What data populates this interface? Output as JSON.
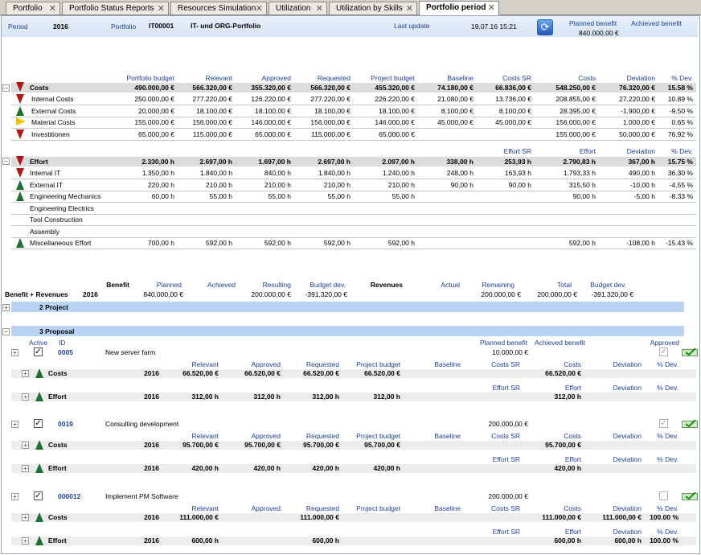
{
  "tabs": [
    {
      "label": "Portfolio",
      "active": false
    },
    {
      "label": "Portfolio Status Reports",
      "active": false
    },
    {
      "label": "Resources Simulation",
      "active": false
    },
    {
      "label": "Utilization",
      "active": false
    },
    {
      "label": "Utilization by Skills",
      "active": false
    },
    {
      "label": "Portfolio period",
      "active": true
    }
  ],
  "header": {
    "period_label": "Period",
    "period": "2016",
    "portfolio_label": "Portfolio",
    "portfolio_id": "IT00001",
    "portfolio_name": "IT- und ORG-Portfolio",
    "last_update_label": "Last update",
    "last_update": "19.07.16 15:21",
    "planned_label": "Planned benefit",
    "planned": "840.000,00 €",
    "achieved_label": "Achieved benefit"
  },
  "budget": {
    "columns": [
      "Portfolio budget",
      "Relevant",
      "Approved",
      "Requested",
      "Project budget",
      "Baseline",
      "Costs SR",
      "Costs",
      "Deviation",
      "% Dev."
    ],
    "costs": {
      "label": "Costs",
      "values": [
        "490.000,00 €",
        "566.320,00 €",
        "355.320,00 €",
        "566.320,00 €",
        "455.320,00 €",
        "74.180,00 €",
        "66.836,00 €",
        "548.250,00 €",
        "76.320,00 €",
        "15.58 %"
      ]
    },
    "cost_rows": [
      {
        "label": "Internal Costs",
        "indicator": "down",
        "values": [
          "250.000,00 €",
          "277.220,00 €",
          "126.220,00 €",
          "277.220,00 €",
          "226.220,00 €",
          "21.080,00 €",
          "13.736,00 €",
          "208.855,00 €",
          "27.220,00 €",
          "10.89 %"
        ]
      },
      {
        "label": "External Costs",
        "indicator": "up",
        "values": [
          "20.000,00 €",
          "18.100,00 €",
          "18.100,00 €",
          "18.100,00 €",
          "18.100,00 €",
          "8.100,00 €",
          "8.100,00 €",
          "28.395,00 €",
          "-1.900,00 €",
          "-9.50 %"
        ]
      },
      {
        "label": "Material Costs",
        "indicator": "flag",
        "values": [
          "155.000,00 €",
          "156.000,00 €",
          "146.000,00 €",
          "156.000,00 €",
          "146.000,00 €",
          "45.000,00 €",
          "45.000,00 €",
          "156.000,00 €",
          "1.000,00 €",
          "0.65 %"
        ]
      },
      {
        "label": "Investitionen",
        "indicator": "down",
        "values": [
          "65.000,00 €",
          "115.000,00 €",
          "65.000,00 €",
          "115.000,00 €",
          "65.000,00 €",
          "",
          "",
          "155.000,00 €",
          "50.000,00 €",
          "76.92 %"
        ]
      }
    ],
    "effort_columns": [
      "Effort SR",
      "Effort",
      "Deviation",
      "% Dev."
    ],
    "effort": {
      "label": "Effort",
      "values": [
        "2.330,00 h",
        "2.697,00 h",
        "1.697,00 h",
        "2.697,00 h",
        "2.097,00 h",
        "338,00 h",
        "253,93 h",
        "2.790,83 h",
        "367,00 h",
        "15.75 %"
      ]
    },
    "effort_rows": [
      {
        "label": "Internal IT",
        "indicator": "down",
        "values": [
          "1.350,00 h",
          "1.840,00 h",
          "840,00 h",
          "1.840,00 h",
          "1.240,00 h",
          "248,00 h",
          "163,93 h",
          "1.793,33 h",
          "490,00 h",
          "36.30 %"
        ]
      },
      {
        "label": "External IT",
        "indicator": "up",
        "values": [
          "220,00 h",
          "210,00 h",
          "210,00 h",
          "210,00 h",
          "210,00 h",
          "90,00 h",
          "90,00 h",
          "315,50 h",
          "-10,00 h",
          "-4.55 %"
        ]
      },
      {
        "label": "Engineering Mechanics",
        "indicator": "up",
        "values": [
          "60,00 h",
          "55,00 h",
          "55,00 h",
          "55,00 h",
          "55,00 h",
          "",
          "",
          "90,00 h",
          "-5,00 h",
          "-8.33 %"
        ]
      },
      {
        "label": "Engineering Electrics",
        "indicator": "",
        "values": [
          "",
          "",
          "",
          "",
          "",
          "",
          "",
          "",
          "",
          ""
        ]
      },
      {
        "label": "Tool Construction",
        "indicator": "",
        "values": [
          "",
          "",
          "",
          "",
          "",
          "",
          "",
          "",
          "",
          ""
        ]
      },
      {
        "label": "Assembly",
        "indicator": "",
        "values": [
          "",
          "",
          "",
          "",
          "",
          "",
          "",
          "",
          "",
          ""
        ]
      },
      {
        "label": "Miscellaneous Effort",
        "indicator": "up",
        "values": [
          "700,00 h",
          "592,00 h",
          "592,00 h",
          "592,00 h",
          "592,00 h",
          "",
          "",
          "592,00 h",
          "-108,00 h",
          "-15.43 %"
        ]
      }
    ]
  },
  "benefit": {
    "benefit_label": "Benefit",
    "planned_label": "Planned",
    "achieved_label": "Achieved",
    "resulting_label": "Resulting",
    "budget_dev_label": "Budget dev.",
    "revenues_label": "Revenues",
    "actual_label": "Actual",
    "remaining_label": "Remaining",
    "total_label": "Total",
    "budget_dev2_label": "Budget dev.",
    "row_label": "Benefit + Revenues",
    "year": "2016",
    "planned": "840.000,00 €",
    "resulting": "200.000,00 €",
    "budget_dev": "-391.320,00 €",
    "remaining": "200.000,00 €",
    "total": "200.000,00 €",
    "budget_dev2": "-391.320,00 €"
  },
  "groups": {
    "project": "2 Project",
    "proposal": "3 Proposal"
  },
  "proposal_header": {
    "active": "Active",
    "id": "ID",
    "planned": "Planned benefit",
    "achieved": "Achieved benefit",
    "approved": "Approved"
  },
  "sub_columns": {
    "relevant": "Relevant",
    "approved": "Approved",
    "requested": "Requested",
    "project_budget": "Project budget",
    "baseline": "Baseline",
    "costs_sr": "Costs SR",
    "costs": "Costs",
    "deviation": "Deviation",
    "pct_dev": "% Dev.",
    "effort_sr": "Effort SR",
    "effort": "Effort"
  },
  "proposals": [
    {
      "id": "0005",
      "name": "New server farm",
      "planned": "10.000,00 €",
      "approved": true,
      "costs": {
        "label": "Costs",
        "year": "2016",
        "relevant": "66.520,00 €",
        "approved": "66.520,00 €",
        "requested": "66.520,00 €",
        "project_budget": "66.520,00 €",
        "costs": "66.520,00 €",
        "deviation": "",
        "pct_dev": ""
      },
      "effort": {
        "label": "Effort",
        "year": "2016",
        "relevant": "312,00 h",
        "approved": "312,00 h",
        "requested": "312,00 h",
        "project_budget": "312,00 h",
        "effort": "312,00 h"
      }
    },
    {
      "id": "0019",
      "name": "Consulting development",
      "planned": "200.000,00 €",
      "approved": true,
      "costs": {
        "label": "Costs",
        "year": "2016",
        "relevant": "95.700,00 €",
        "approved": "95.700,00 €",
        "requested": "95.700,00 €",
        "project_budget": "95.700,00 €",
        "costs": "95.700,00 €",
        "deviation": "",
        "pct_dev": ""
      },
      "effort": {
        "label": "Effort",
        "year": "2016",
        "relevant": "420,00 h",
        "approved": "420,00 h",
        "requested": "420,00 h",
        "project_budget": "420,00 h",
        "effort": "420,00 h"
      }
    },
    {
      "id": "000012",
      "name": "Implement PM Software",
      "planned": "200.000,00 €",
      "approved": false,
      "costs": {
        "label": "Costs",
        "year": "2016",
        "relevant": "111.000,00 €",
        "approved": "",
        "requested": "111.000,00 €",
        "project_budget": "",
        "costs": "111.000,00 €",
        "deviation": "111.000,00 €",
        "pct_dev": "100.00 %"
      },
      "effort": {
        "label": "Effort",
        "year": "2016",
        "relevant": "600,00 h",
        "approved": "",
        "requested": "600,00 h",
        "project_budget": "",
        "effort": "600,00 h",
        "deviation": "600,00 h",
        "pct_dev": "100.00 %"
      }
    }
  ]
}
